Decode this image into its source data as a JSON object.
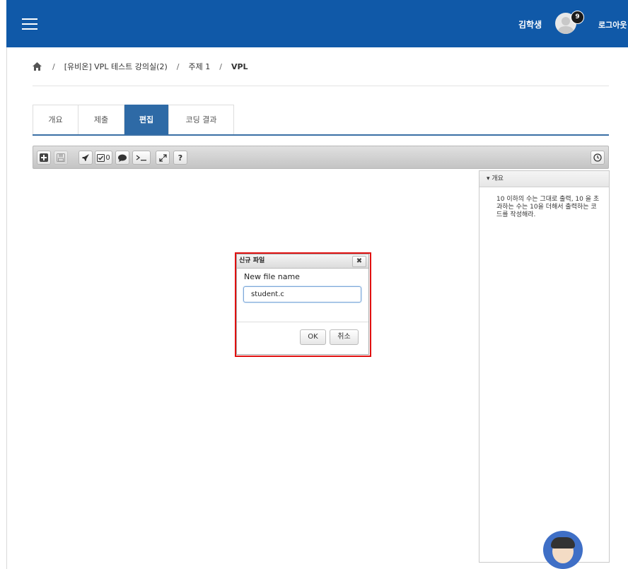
{
  "header": {
    "user_name": "김학생",
    "notification_count": "9",
    "logout_label": "로그아웃",
    "menu_icon": "hamburger-icon",
    "bg_color": "#1059a8"
  },
  "breadcrumb": {
    "home_icon": "home-icon",
    "items": [
      "[유비온] VPL 테스트 강의실(2)",
      "주제 1",
      "VPL"
    ],
    "separator": "/"
  },
  "tabs": [
    {
      "label": "개요",
      "active": false
    },
    {
      "label": "제출",
      "active": false
    },
    {
      "label": "편집",
      "active": true
    },
    {
      "label": "코딩 결과",
      "active": false
    }
  ],
  "toolbar": {
    "check_count": "0",
    "help_label": "?",
    "buttons": [
      "new-file-icon",
      "save-icon",
      "run-icon",
      "evaluate-icon",
      "comment-icon",
      "console-icon",
      "fullscreen-icon",
      "help-icon",
      "clock-icon"
    ]
  },
  "side_panel": {
    "title": "개요",
    "description": "10 이하의 수는 그대로 출력, 10 을 초과하는 수는 10을 더해서 출력하는 코드를 작성해라."
  },
  "dialog": {
    "title": "신규 파일",
    "close_label": "✖",
    "field_label": "New file name",
    "field_value": "student.c",
    "ok_label": "OK",
    "cancel_label": "취소",
    "highlight_color": "#e01010"
  },
  "chatbot": {
    "icon": "chatbot-avatar-icon"
  }
}
